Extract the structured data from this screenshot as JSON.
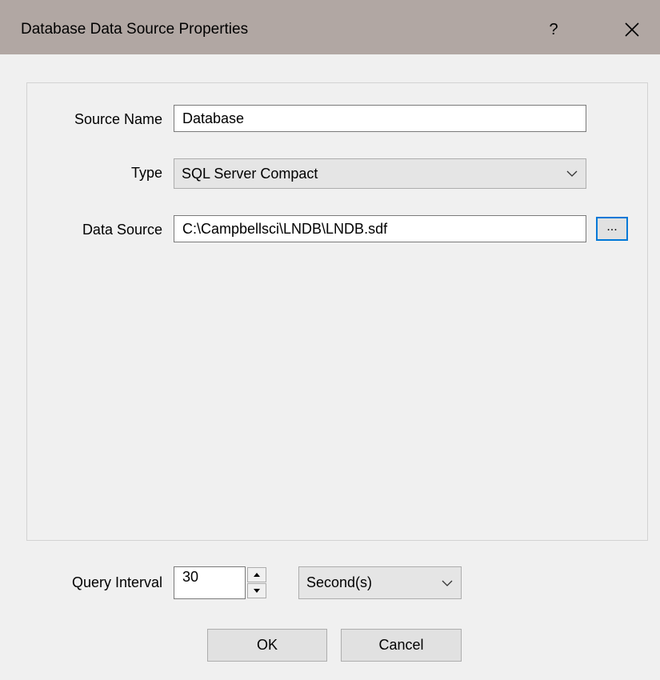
{
  "window": {
    "title": "Database Data Source Properties",
    "help_label": "?",
    "close_icon": "close-icon"
  },
  "form": {
    "source_name_label": "Source Name",
    "source_name_value": "Database",
    "type_label": "Type",
    "type_value": "SQL Server Compact",
    "data_source_label": "Data Source",
    "data_source_value": "C:\\Campbellsci\\LNDB\\LNDB.sdf",
    "browse_label": "..."
  },
  "query": {
    "label": "Query Interval",
    "value": "30",
    "unit_value": "Second(s)"
  },
  "buttons": {
    "ok_label": "OK",
    "cancel_label": "Cancel"
  },
  "colors": {
    "titlebar": "#b1a7a3",
    "window_bg": "#f0f0f0",
    "focus_border": "#0078d7"
  }
}
